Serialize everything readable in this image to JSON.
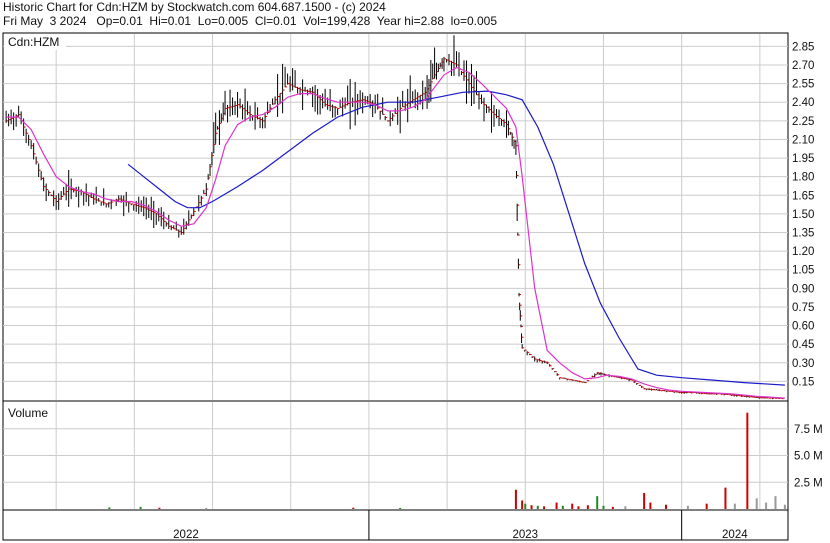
{
  "header": {
    "line1": "Historic Chart for Cdn:HZM by Stockwatch.com 604.687.1500 - (c) 2024",
    "line2": "Fri May  3 2024   Op=0.01  Hi=0.01  Lo=0.005  Cl=0.01  Vol=199,428  Year hi=2.88  lo=0.005"
  },
  "chart_data": {
    "type": "line",
    "symbol_label": "Cdn:HZM",
    "volume_label": "Volume",
    "price_axis_ticks": [
      "2.85",
      "2.70",
      "2.55",
      "2.40",
      "2.25",
      "2.10",
      "1.95",
      "1.80",
      "1.65",
      "1.50",
      "1.35",
      "1.20",
      "1.05",
      "0.90",
      "0.75",
      "0.60",
      "0.45",
      "0.30",
      "0.15"
    ],
    "volume_axis_ticks": [
      "7.5 M",
      "5.0 M",
      "2.5 M"
    ],
    "year_labels": [
      "2022",
      "2023",
      "2024"
    ],
    "ylim": [
      0,
      2.95
    ],
    "volume_ylim": [
      0,
      10000000
    ],
    "x_range": [
      2021.83,
      2024.34
    ],
    "year_boundaries": [
      2023.0,
      2024.0
    ],
    "colors": {
      "price": "#000000",
      "close_tick": "#cc0000",
      "ma_short": "#dd33cc",
      "ma_long": "#1a1acc",
      "vol_up": "#228822",
      "vol_down": "#cc0000",
      "vol_flat": "#999999",
      "grid": "#cccccc"
    },
    "price_series": [
      {
        "x": 2021.84,
        "close": 2.25
      },
      {
        "x": 2021.88,
        "close": 2.3
      },
      {
        "x": 2021.92,
        "close": 2.05
      },
      {
        "x": 2021.96,
        "close": 1.72
      },
      {
        "x": 2022.0,
        "close": 1.6
      },
      {
        "x": 2022.04,
        "close": 1.7
      },
      {
        "x": 2022.08,
        "close": 1.68
      },
      {
        "x": 2022.12,
        "close": 1.62
      },
      {
        "x": 2022.16,
        "close": 1.58
      },
      {
        "x": 2022.2,
        "close": 1.62
      },
      {
        "x": 2022.24,
        "close": 1.58
      },
      {
        "x": 2022.28,
        "close": 1.55
      },
      {
        "x": 2022.32,
        "close": 1.5
      },
      {
        "x": 2022.36,
        "close": 1.4
      },
      {
        "x": 2022.4,
        "close": 1.35
      },
      {
        "x": 2022.44,
        "close": 1.52
      },
      {
        "x": 2022.48,
        "close": 1.7
      },
      {
        "x": 2022.51,
        "close": 2.15
      },
      {
        "x": 2022.54,
        "close": 2.35
      },
      {
        "x": 2022.58,
        "close": 2.38
      },
      {
        "x": 2022.62,
        "close": 2.3
      },
      {
        "x": 2022.66,
        "close": 2.25
      },
      {
        "x": 2022.7,
        "close": 2.42
      },
      {
        "x": 2022.74,
        "close": 2.55
      },
      {
        "x": 2022.78,
        "close": 2.5
      },
      {
        "x": 2022.82,
        "close": 2.48
      },
      {
        "x": 2022.86,
        "close": 2.38
      },
      {
        "x": 2022.9,
        "close": 2.35
      },
      {
        "x": 2022.94,
        "close": 2.4
      },
      {
        "x": 2022.98,
        "close": 2.42
      },
      {
        "x": 2023.02,
        "close": 2.38
      },
      {
        "x": 2023.06,
        "close": 2.25
      },
      {
        "x": 2023.1,
        "close": 2.35
      },
      {
        "x": 2023.14,
        "close": 2.42
      },
      {
        "x": 2023.18,
        "close": 2.48
      },
      {
        "x": 2023.21,
        "close": 2.62
      },
      {
        "x": 2023.24,
        "close": 2.75
      },
      {
        "x": 2023.28,
        "close": 2.7
      },
      {
        "x": 2023.32,
        "close": 2.55
      },
      {
        "x": 2023.36,
        "close": 2.4
      },
      {
        "x": 2023.4,
        "close": 2.3
      },
      {
        "x": 2023.44,
        "close": 2.22
      },
      {
        "x": 2023.47,
        "close": 2.05
      },
      {
        "x": 2023.48,
        "close": 0.85
      },
      {
        "x": 2023.49,
        "close": 0.42
      },
      {
        "x": 2023.53,
        "close": 0.33
      },
      {
        "x": 2023.57,
        "close": 0.3
      },
      {
        "x": 2023.61,
        "close": 0.18
      },
      {
        "x": 2023.65,
        "close": 0.16
      },
      {
        "x": 2023.69,
        "close": 0.14
      },
      {
        "x": 2023.73,
        "close": 0.22
      },
      {
        "x": 2023.76,
        "close": 0.2
      },
      {
        "x": 2023.8,
        "close": 0.18
      },
      {
        "x": 2023.84,
        "close": 0.16
      },
      {
        "x": 2023.88,
        "close": 0.09
      },
      {
        "x": 2023.92,
        "close": 0.08
      },
      {
        "x": 2023.96,
        "close": 0.07
      },
      {
        "x": 2024.0,
        "close": 0.06
      },
      {
        "x": 2024.04,
        "close": 0.06
      },
      {
        "x": 2024.08,
        "close": 0.05
      },
      {
        "x": 2024.12,
        "close": 0.05
      },
      {
        "x": 2024.16,
        "close": 0.04
      },
      {
        "x": 2024.2,
        "close": 0.03
      },
      {
        "x": 2024.24,
        "close": 0.02
      },
      {
        "x": 2024.28,
        "close": 0.015
      },
      {
        "x": 2024.33,
        "close": 0.01
      }
    ],
    "ma_short": [
      {
        "x": 2021.84,
        "y": 2.28
      },
      {
        "x": 2021.88,
        "y": 2.28
      },
      {
        "x": 2021.92,
        "y": 2.18
      },
      {
        "x": 2021.96,
        "y": 1.98
      },
      {
        "x": 2022.0,
        "y": 1.8
      },
      {
        "x": 2022.04,
        "y": 1.72
      },
      {
        "x": 2022.08,
        "y": 1.68
      },
      {
        "x": 2022.12,
        "y": 1.66
      },
      {
        "x": 2022.16,
        "y": 1.62
      },
      {
        "x": 2022.2,
        "y": 1.6
      },
      {
        "x": 2022.24,
        "y": 1.6
      },
      {
        "x": 2022.28,
        "y": 1.57
      },
      {
        "x": 2022.32,
        "y": 1.52
      },
      {
        "x": 2022.36,
        "y": 1.45
      },
      {
        "x": 2022.4,
        "y": 1.4
      },
      {
        "x": 2022.44,
        "y": 1.42
      },
      {
        "x": 2022.48,
        "y": 1.55
      },
      {
        "x": 2022.51,
        "y": 1.78
      },
      {
        "x": 2022.54,
        "y": 2.05
      },
      {
        "x": 2022.58,
        "y": 2.22
      },
      {
        "x": 2022.62,
        "y": 2.28
      },
      {
        "x": 2022.66,
        "y": 2.3
      },
      {
        "x": 2022.7,
        "y": 2.36
      },
      {
        "x": 2022.74,
        "y": 2.44
      },
      {
        "x": 2022.78,
        "y": 2.47
      },
      {
        "x": 2022.82,
        "y": 2.47
      },
      {
        "x": 2022.86,
        "y": 2.43
      },
      {
        "x": 2022.9,
        "y": 2.4
      },
      {
        "x": 2022.94,
        "y": 2.4
      },
      {
        "x": 2022.98,
        "y": 2.4
      },
      {
        "x": 2023.02,
        "y": 2.38
      },
      {
        "x": 2023.06,
        "y": 2.33
      },
      {
        "x": 2023.1,
        "y": 2.33
      },
      {
        "x": 2023.14,
        "y": 2.36
      },
      {
        "x": 2023.18,
        "y": 2.42
      },
      {
        "x": 2023.21,
        "y": 2.52
      },
      {
        "x": 2023.24,
        "y": 2.62
      },
      {
        "x": 2023.28,
        "y": 2.68
      },
      {
        "x": 2023.32,
        "y": 2.64
      },
      {
        "x": 2023.36,
        "y": 2.55
      },
      {
        "x": 2023.4,
        "y": 2.45
      },
      {
        "x": 2023.44,
        "y": 2.35
      },
      {
        "x": 2023.47,
        "y": 2.2
      },
      {
        "x": 2023.49,
        "y": 1.8
      },
      {
        "x": 2023.53,
        "y": 0.9
      },
      {
        "x": 2023.57,
        "y": 0.4
      },
      {
        "x": 2023.61,
        "y": 0.3
      },
      {
        "x": 2023.65,
        "y": 0.22
      },
      {
        "x": 2023.69,
        "y": 0.17
      },
      {
        "x": 2023.73,
        "y": 0.18
      },
      {
        "x": 2023.76,
        "y": 0.2
      },
      {
        "x": 2023.8,
        "y": 0.19
      },
      {
        "x": 2023.84,
        "y": 0.17
      },
      {
        "x": 2023.88,
        "y": 0.13
      },
      {
        "x": 2023.92,
        "y": 0.1
      },
      {
        "x": 2023.96,
        "y": 0.08
      },
      {
        "x": 2024.0,
        "y": 0.07
      },
      {
        "x": 2024.08,
        "y": 0.06
      },
      {
        "x": 2024.16,
        "y": 0.05
      },
      {
        "x": 2024.24,
        "y": 0.03
      },
      {
        "x": 2024.33,
        "y": 0.015
      }
    ],
    "ma_long": [
      {
        "x": 2022.23,
        "y": 1.9
      },
      {
        "x": 2022.28,
        "y": 1.8
      },
      {
        "x": 2022.33,
        "y": 1.7
      },
      {
        "x": 2022.38,
        "y": 1.6
      },
      {
        "x": 2022.42,
        "y": 1.55
      },
      {
        "x": 2022.46,
        "y": 1.55
      },
      {
        "x": 2022.5,
        "y": 1.6
      },
      {
        "x": 2022.58,
        "y": 1.72
      },
      {
        "x": 2022.66,
        "y": 1.85
      },
      {
        "x": 2022.74,
        "y": 2.0
      },
      {
        "x": 2022.82,
        "y": 2.15
      },
      {
        "x": 2022.9,
        "y": 2.28
      },
      {
        "x": 2022.98,
        "y": 2.36
      },
      {
        "x": 2023.06,
        "y": 2.4
      },
      {
        "x": 2023.14,
        "y": 2.4
      },
      {
        "x": 2023.22,
        "y": 2.44
      },
      {
        "x": 2023.3,
        "y": 2.48
      },
      {
        "x": 2023.38,
        "y": 2.49
      },
      {
        "x": 2023.44,
        "y": 2.46
      },
      {
        "x": 2023.49,
        "y": 2.42
      },
      {
        "x": 2023.54,
        "y": 2.2
      },
      {
        "x": 2023.59,
        "y": 1.9
      },
      {
        "x": 2023.64,
        "y": 1.5
      },
      {
        "x": 2023.69,
        "y": 1.1
      },
      {
        "x": 2023.74,
        "y": 0.78
      },
      {
        "x": 2023.8,
        "y": 0.5
      },
      {
        "x": 2023.86,
        "y": 0.25
      },
      {
        "x": 2023.92,
        "y": 0.2
      },
      {
        "x": 2024.0,
        "y": 0.18
      },
      {
        "x": 2024.1,
        "y": 0.16
      },
      {
        "x": 2024.2,
        "y": 0.14
      },
      {
        "x": 2024.33,
        "y": 0.12
      }
    ],
    "volume": [
      {
        "x": 2022.17,
        "v": 150000,
        "dir": "up"
      },
      {
        "x": 2022.27,
        "v": 200000,
        "dir": "up"
      },
      {
        "x": 2022.33,
        "v": 120000,
        "dir": "down"
      },
      {
        "x": 2022.48,
        "v": 100000,
        "dir": "flat"
      },
      {
        "x": 2022.95,
        "v": 120000,
        "dir": "down"
      },
      {
        "x": 2023.1,
        "v": 100000,
        "dir": "up"
      },
      {
        "x": 2023.47,
        "v": 1800000,
        "dir": "down"
      },
      {
        "x": 2023.49,
        "v": 800000,
        "dir": "down"
      },
      {
        "x": 2023.5,
        "v": 500000,
        "dir": "up"
      },
      {
        "x": 2023.52,
        "v": 350000,
        "dir": "down"
      },
      {
        "x": 2023.54,
        "v": 300000,
        "dir": "up"
      },
      {
        "x": 2023.56,
        "v": 250000,
        "dir": "down"
      },
      {
        "x": 2023.6,
        "v": 600000,
        "dir": "down"
      },
      {
        "x": 2023.62,
        "v": 300000,
        "dir": "up"
      },
      {
        "x": 2023.65,
        "v": 500000,
        "dir": "down"
      },
      {
        "x": 2023.67,
        "v": 250000,
        "dir": "down"
      },
      {
        "x": 2023.7,
        "v": 350000,
        "dir": "down"
      },
      {
        "x": 2023.73,
        "v": 1200000,
        "dir": "up"
      },
      {
        "x": 2023.75,
        "v": 300000,
        "dir": "up"
      },
      {
        "x": 2023.78,
        "v": 200000,
        "dir": "down"
      },
      {
        "x": 2023.82,
        "v": 250000,
        "dir": "flat"
      },
      {
        "x": 2023.88,
        "v": 1500000,
        "dir": "down"
      },
      {
        "x": 2023.9,
        "v": 600000,
        "dir": "down"
      },
      {
        "x": 2023.95,
        "v": 400000,
        "dir": "down"
      },
      {
        "x": 2024.02,
        "v": 300000,
        "dir": "flat"
      },
      {
        "x": 2024.08,
        "v": 500000,
        "dir": "down"
      },
      {
        "x": 2024.14,
        "v": 2000000,
        "dir": "down"
      },
      {
        "x": 2024.17,
        "v": 500000,
        "dir": "flat"
      },
      {
        "x": 2024.21,
        "v": 9000000,
        "dir": "down"
      },
      {
        "x": 2024.24,
        "v": 1000000,
        "dir": "flat"
      },
      {
        "x": 2024.27,
        "v": 600000,
        "dir": "flat"
      },
      {
        "x": 2024.3,
        "v": 1200000,
        "dir": "flat"
      },
      {
        "x": 2024.33,
        "v": 400000,
        "dir": "flat"
      }
    ]
  }
}
